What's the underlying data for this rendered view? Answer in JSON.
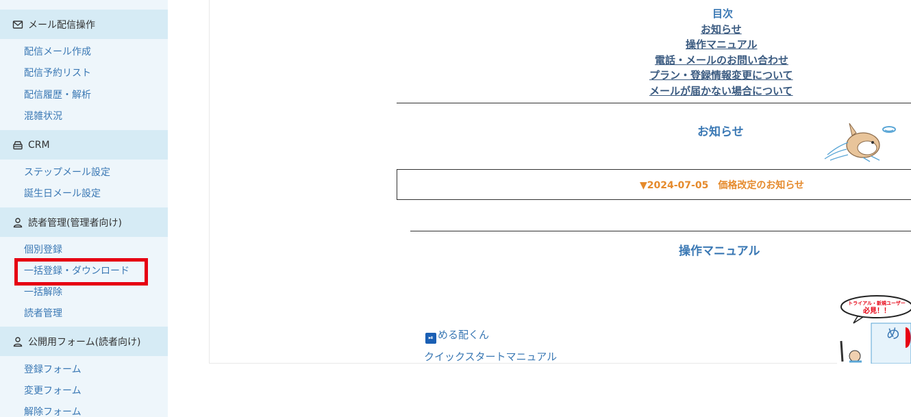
{
  "sidebar": {
    "sections": [
      {
        "label": "メール配信操作",
        "icon": "mail-icon",
        "items": [
          "配信メール作成",
          "配信予約リスト",
          "配信履歴・解析",
          "混雑状況"
        ]
      },
      {
        "label": "CRM",
        "icon": "crm-icon",
        "items": [
          "ステップメール設定",
          "誕生日メール設定"
        ]
      },
      {
        "label": "読者管理(管理者向け)",
        "icon": "user-icon",
        "items": [
          "個別登録",
          "一括登録・ダウンロード",
          "一括解除",
          "読者管理"
        ]
      },
      {
        "label": "公開用フォーム(読者向け)",
        "icon": "user-icon",
        "items": [
          "登録フォーム",
          "変更フォーム",
          "解除フォーム"
        ]
      }
    ],
    "highlight_color": "#e60012"
  },
  "toc": {
    "title": "目次",
    "links": [
      "お知らせ",
      "操作マニュアル",
      "電話・メールのお問い合わせ",
      "プラン・登録情報変更について",
      "メールが届かない場合について"
    ]
  },
  "news": {
    "title": "お知らせ",
    "item": "▼2024-07-05　価格改定のお知らせ",
    "accent": "#e58a2c"
  },
  "manual": {
    "title": "操作マニュアル",
    "links": [
      "める配くん",
      "クイックスタートマニュアル"
    ],
    "banner_caption": "トライアル・新規ユーザー",
    "banner_must": "必見！！",
    "banner_big": "め"
  },
  "colors": {
    "link": "#3a78b4",
    "sidebar_bg": "#eef6fb",
    "sidebar_head_bg": "#d6ebf5"
  }
}
